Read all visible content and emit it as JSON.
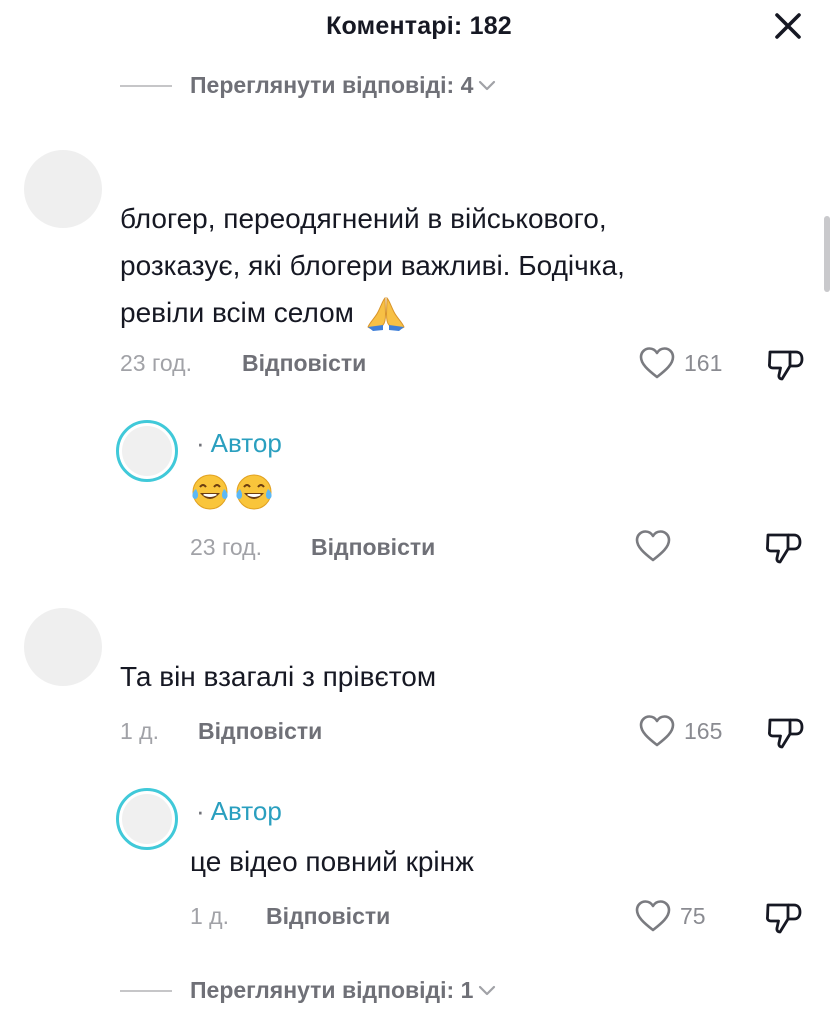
{
  "header": {
    "title": "Коментарі: 182"
  },
  "replies_toggle_top": {
    "label": "Переглянути відповіді: 4"
  },
  "comments": [
    {
      "text_lines": [
        "блогер, переодягнений в військового,",
        "розказує, які блогери важливі. Бодічка,",
        "ревіли всім селом"
      ],
      "emoji": "folded-hands",
      "time": "23 год.",
      "reply_label": "Відповісти",
      "likes": "161",
      "reply": {
        "author_tag": "Автор",
        "author_dot": "·",
        "emoji": "face-with-tears-of-joy ×2",
        "time": "23 год.",
        "reply_label": "Відповісти",
        "likes": ""
      }
    },
    {
      "text_lines": [
        "Та він взагалі з прівєтом"
      ],
      "time": "1 д.",
      "reply_label": "Відповісти",
      "likes": "165",
      "reply": {
        "author_tag": "Автор",
        "author_dot": "·",
        "text": "це відео повний крінж",
        "time": "1 д.",
        "reply_label": "Відповісти",
        "likes": "75"
      }
    }
  ],
  "replies_toggle_bottom": {
    "label": "Переглянути відповіді: 1"
  },
  "icons": {
    "close": "close-icon",
    "like": "heart-outline-icon",
    "dislike": "thumbs-down-icon",
    "chevron": "chevron-down-icon"
  },
  "colors": {
    "text": "#161823",
    "secondary": "#6f7077",
    "muted": "#a1a2a7",
    "author_accent": "#2a9fbf",
    "avatar_ring": "#40c9d9"
  }
}
